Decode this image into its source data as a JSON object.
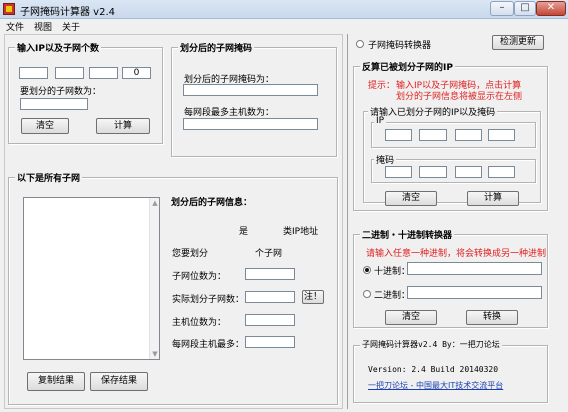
{
  "window": {
    "title": "子网掩码计算器 v2.4"
  },
  "menu": [
    "文件",
    "视图",
    "关于"
  ],
  "input_group": {
    "title": "输入IP以及子网个数",
    "ip_octets": [
      "",
      "",
      "",
      "0"
    ],
    "subnet_count_label": "要划分的子网数为：",
    "subnet_count_value": "",
    "clear_label": "清空",
    "calc_label": "计算"
  },
  "mask_group": {
    "title": "划分后的子网掩码",
    "mask_label": "划分后的子网掩码为：",
    "mask_value": "",
    "hosts_label": "每网段最多主机数为：",
    "hosts_value": ""
  },
  "subnets_group": {
    "title": "以下是所有子网",
    "info_title": "划分后的子网信息：",
    "is_label": "是",
    "class_label": "类IP地址",
    "you_label": "您要划分",
    "count_label": "个子网",
    "bits_label": "子网位数为：",
    "actual_label": "实际划分子网数：",
    "note_label": "注！",
    "host_bits_label": "主机位数为：",
    "max_hosts_label": "每网段主机最多：",
    "copy_label": "复制结果",
    "save_label": "保存结果"
  },
  "right_panel": {
    "converter_radio_label": "子网掩码转换器",
    "update_label": "检测更新",
    "reverse_title": "反算已被划分子网的IP",
    "hint_prefix": "提示：",
    "hint_line1": "输入IP以及子网掩码，点击计算",
    "hint_line2": "划分的子网信息将被显示在左侧",
    "enter_title": "请输入已划分子网的IP以及掩码",
    "ip_label": "IP",
    "ip_octets": [
      "",
      "",
      "",
      ""
    ],
    "mask_label": "掩码",
    "mask_octets": [
      "",
      "",
      "",
      ""
    ],
    "clear_label": "清空",
    "calc_label": "计算"
  },
  "bin_group": {
    "title": "二进制・十进制转换器",
    "hint": "请输入任意一种进制，将会转换成另一种进制",
    "dec_label": "十进制：",
    "dec_value": "",
    "bin_label": "二进制：",
    "bin_value": "",
    "clear_label": "清空",
    "convert_label": "转换"
  },
  "about_group": {
    "title": "子网掩码计算器v2.4 By：一把刀论坛",
    "version_line": "Version: 2.4   Build 20140320",
    "link_text": "一把刀论坛 - 中国最大IT技术交流平台"
  },
  "colors": {
    "hint": "#e02020",
    "link": "#1a3fb0"
  }
}
